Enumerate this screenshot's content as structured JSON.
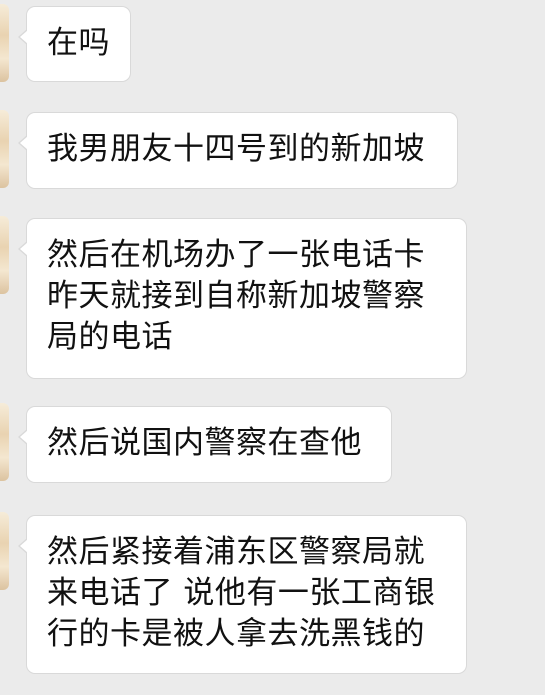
{
  "messages": [
    {
      "text": "在吗"
    },
    {
      "text": "我男朋友十四号到的新加坡"
    },
    {
      "text": "然后在机场办了一张电话卡\n昨天就接到自称新加坡警察\n局的电话"
    },
    {
      "text": "然后说国内警察在查他"
    },
    {
      "text": "然后紧接着浦东区警察局就\n来电话了 说他有一张工商银\n行的卡是被人拿去洗黑钱的"
    }
  ]
}
